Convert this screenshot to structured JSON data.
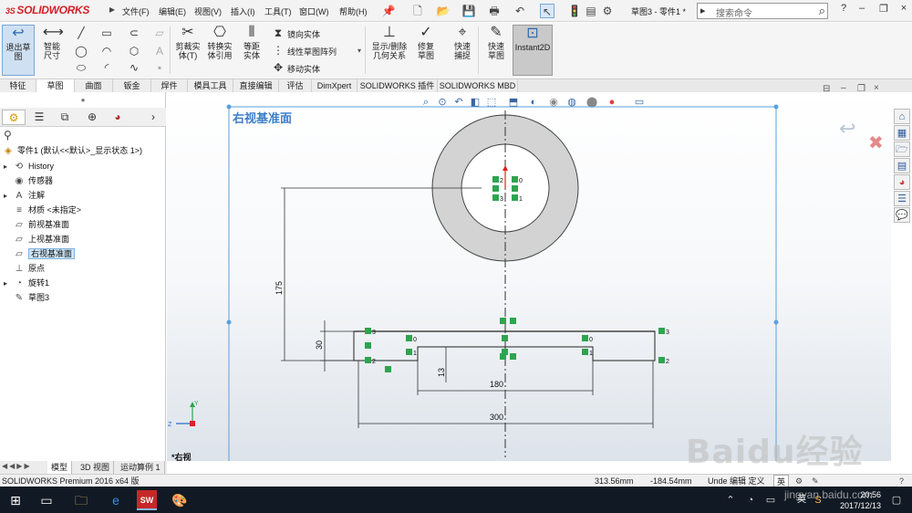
{
  "app": {
    "logo_ds": "3S",
    "logo_name": "SOLIDWORKS",
    "menus": [
      "文件(F)",
      "编辑(E)",
      "视图(V)",
      "插入(I)",
      "工具(T)",
      "窗口(W)",
      "帮助(H)"
    ],
    "doc_title": "草图3 - 零件1 *",
    "search_placeholder": "搜索命令",
    "window_controls": {
      "help": "?",
      "minimize": "–",
      "restore": "❐",
      "close": "×"
    }
  },
  "command_manager": {
    "exit_sketch": "退出草图",
    "smart_dimension": "智能尺寸",
    "trim": "剪裁实体(T)",
    "convert": "转换实体引用",
    "offset": "等距实体",
    "mirror": "镜向实体",
    "linear_pattern": "线性草图阵列",
    "move": "移动实体",
    "show_delete": "显示/删除几何关系",
    "repair": "修复草图",
    "quick_snaps": "快速捕捉",
    "rapid_sketch": "快速草图",
    "instant2d": "Instant2D"
  },
  "tabs": [
    "特征",
    "草图",
    "曲面",
    "钣金",
    "焊件",
    "模具工具",
    "直接编辑",
    "评估",
    "DimXpert",
    "SOLIDWORKS 插件",
    "SOLIDWORKS MBD"
  ],
  "active_tab": "草图",
  "tree": {
    "root": "零件1 (默认<<默认>_显示状态 1>)",
    "items": [
      {
        "label": "History",
        "icon": "history-icon",
        "expand": true
      },
      {
        "label": "传感器",
        "icon": "sensor-icon",
        "expand": false
      },
      {
        "label": "注解",
        "icon": "annotation-icon",
        "expand": true
      },
      {
        "label": "材质 <未指定>",
        "icon": "material-icon",
        "expand": false
      },
      {
        "label": "前视基准面",
        "icon": "plane-icon",
        "expand": false
      },
      {
        "label": "上视基准面",
        "icon": "plane-icon",
        "expand": false
      },
      {
        "label": "右视基准面",
        "icon": "plane-icon",
        "expand": false,
        "selected": true
      },
      {
        "label": "原点",
        "icon": "origin-icon",
        "expand": false
      },
      {
        "label": "旋转1",
        "icon": "revolve-icon",
        "expand": true
      },
      {
        "label": "草图3",
        "icon": "sketch-icon",
        "expand": false
      }
    ]
  },
  "graphics": {
    "plane_label": "右视基准面",
    "view_label": "*右视",
    "dimensions": {
      "d175": "175",
      "d30": "30",
      "d13": "13",
      "d180": "180",
      "d300": "300"
    },
    "relation_tags": [
      "2",
      "0",
      "3",
      "1",
      "3",
      "0",
      "0",
      "3",
      "1",
      "1",
      "2",
      "2"
    ]
  },
  "model_tabs": [
    "模型",
    "3D 视图",
    "运动算例 1"
  ],
  "status": {
    "product": "SOLIDWORKS Premium 2016 x64 版",
    "x": "313.56mm",
    "y": "-184.54mm",
    "state": "Unde 编辑 定义"
  },
  "taskbar": {
    "lang": "英",
    "time": "20:56",
    "date": "2017/12/13"
  },
  "watermark": {
    "main": "Baidu经验",
    "sub": "jingyan.baidu.com"
  }
}
